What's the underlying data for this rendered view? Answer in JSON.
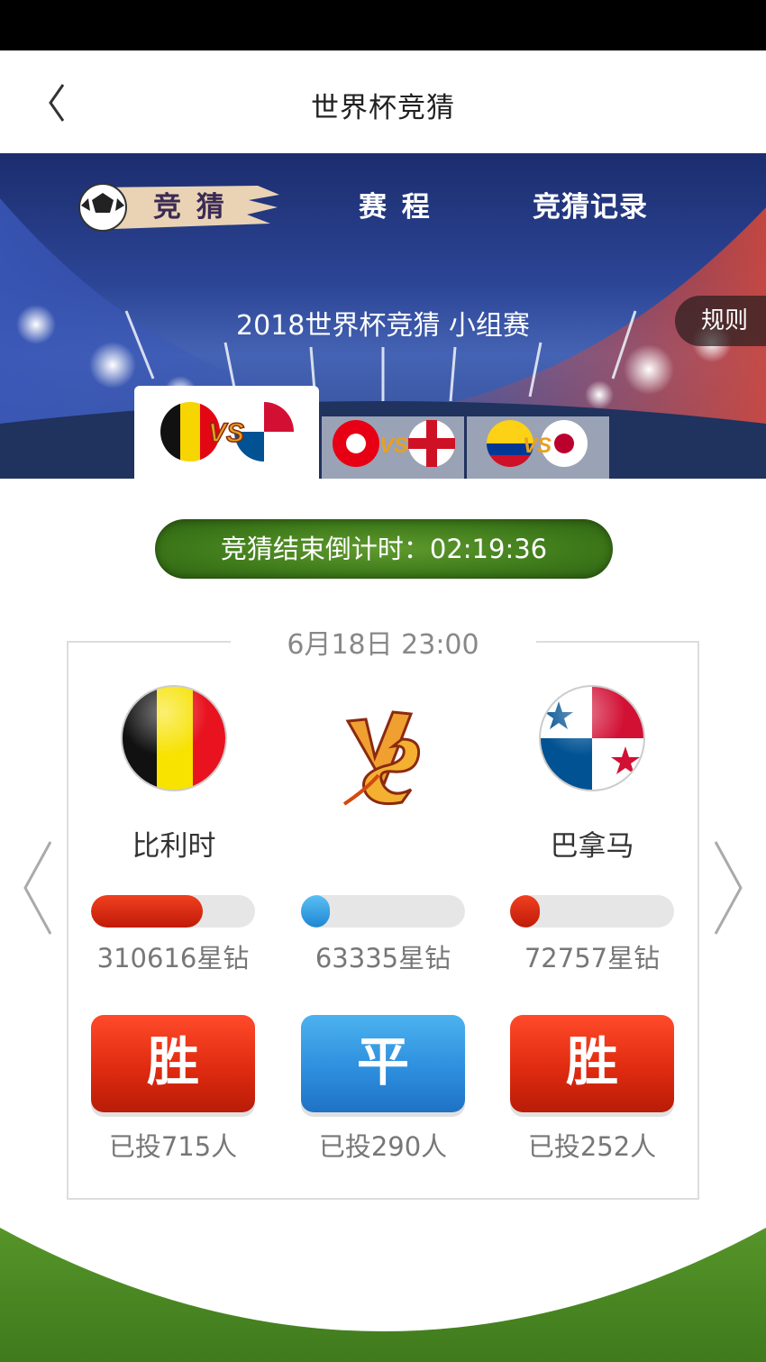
{
  "nav": {
    "title": "世界杯竞猜"
  },
  "tabs": [
    {
      "label": "竞 猜"
    },
    {
      "label": "赛 程"
    },
    {
      "label": "竞猜记录"
    }
  ],
  "banner": {
    "subtitle": "2018世界杯竞猜 小组赛",
    "rules_label": "规则"
  },
  "countdown": {
    "text": "竞猜结束倒计时：02:19:36"
  },
  "match": {
    "time": "6月18日 23:00",
    "home": {
      "name": "比利时",
      "stake": "310616星钻",
      "stake_share": 0.68,
      "bet_label": "胜",
      "voted": "已投715人"
    },
    "draw": {
      "stake": "63335星钻",
      "stake_share": 0.14,
      "bet_label": "平",
      "voted": "已投290人"
    },
    "away": {
      "name": "巴拿马",
      "stake": "72757星钻",
      "stake_share": 0.18,
      "bet_label": "胜",
      "voted": "已投252人"
    }
  },
  "colors": {
    "accent_red": "#e02b10",
    "accent_blue": "#2e8fde",
    "grass_green": "#4a8a22"
  }
}
